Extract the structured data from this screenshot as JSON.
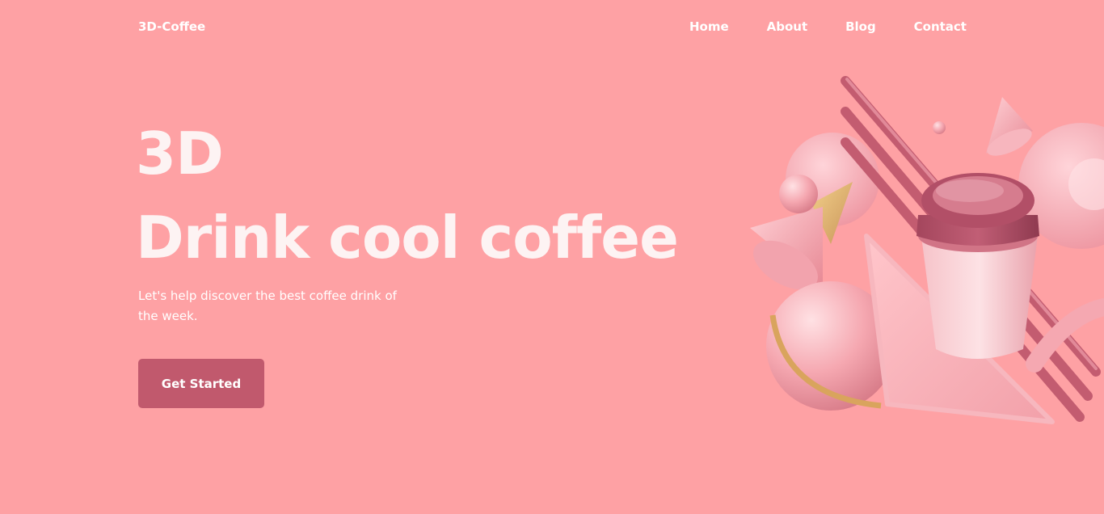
{
  "header": {
    "logo": "3D-Coffee",
    "nav": [
      {
        "label": "Home"
      },
      {
        "label": "About"
      },
      {
        "label": "Blog"
      },
      {
        "label": "Contact"
      }
    ]
  },
  "hero": {
    "title_line1": "3D",
    "title_line2": "Drink cool coffee",
    "subtitle": "Let's help discover the best coffee drink of the week.",
    "cta_label": "Get Started"
  },
  "colors": {
    "background": "#fea1a4",
    "button": "#c1596d",
    "text": "#ffffff"
  }
}
